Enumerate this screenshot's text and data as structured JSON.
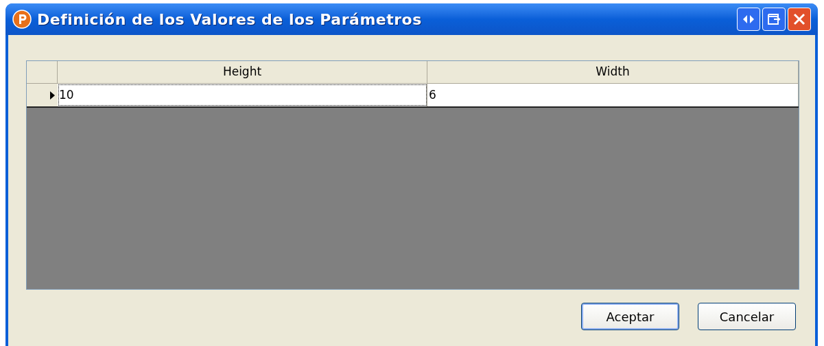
{
  "window": {
    "title": "Definición de los Valores de los Parámetros"
  },
  "grid": {
    "columns": [
      "Height",
      "Width"
    ],
    "rows": [
      {
        "cells": [
          "10",
          "6"
        ],
        "selected": true
      }
    ]
  },
  "buttons": [
    {
      "label": "Aceptar",
      "default": true
    },
    {
      "label": "Cancelar",
      "default": false
    }
  ]
}
